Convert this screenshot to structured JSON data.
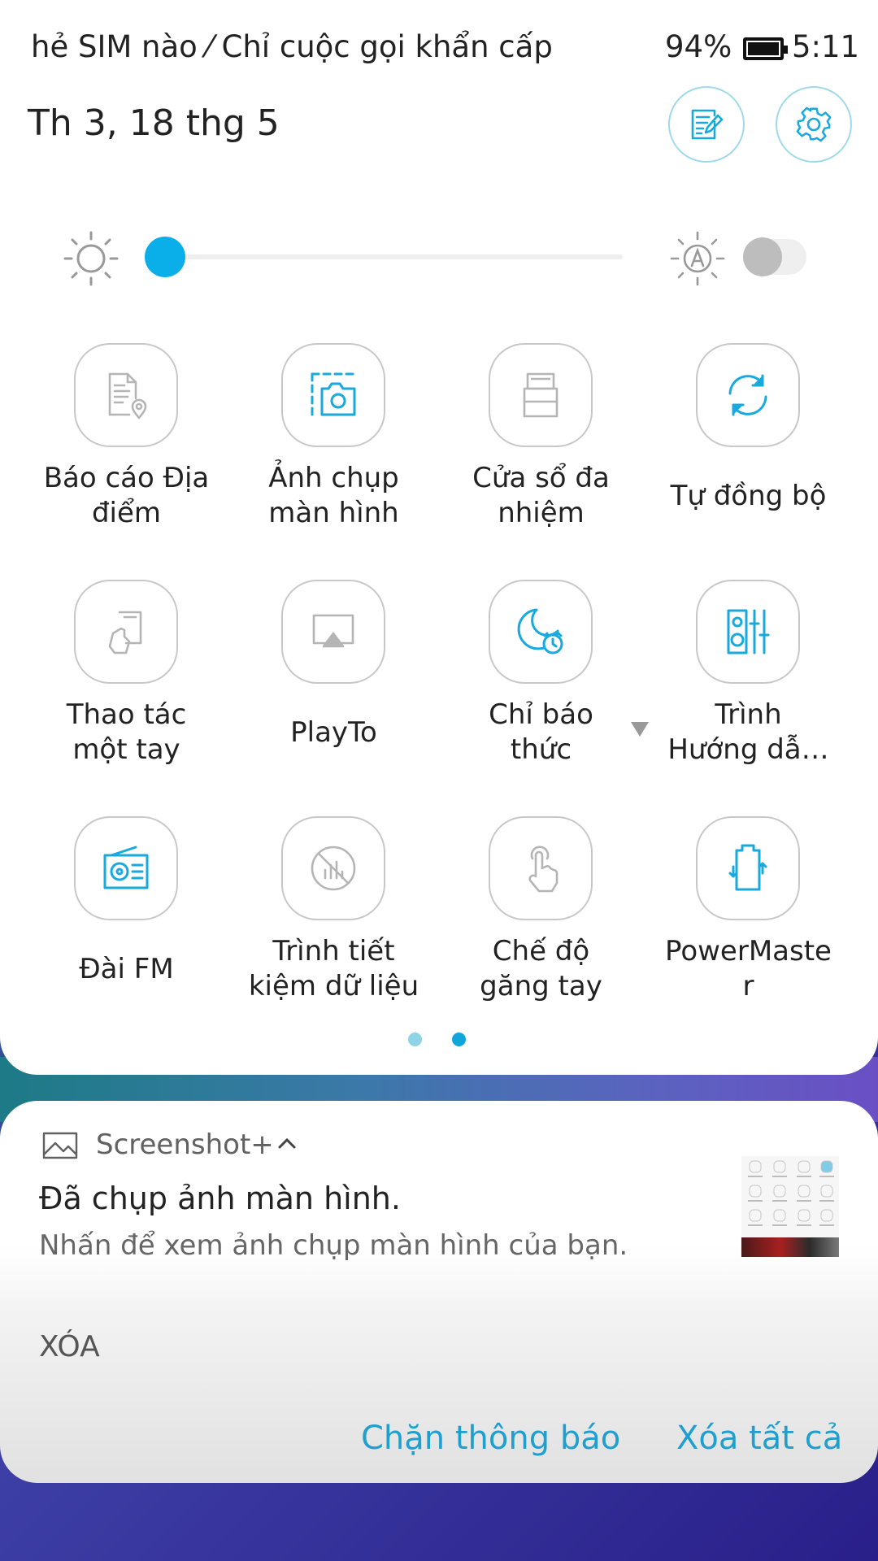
{
  "status_bar": {
    "carrier_text": "hẻ SIM nào ⁄ Chỉ cuộc gọi khẩn cấp",
    "battery_percent": "94%",
    "time": "5:11"
  },
  "header": {
    "date": "Th 3, 18 thg 5"
  },
  "brightness": {
    "level_fraction": 0.0,
    "auto": false
  },
  "tiles": [
    {
      "label_lines": [
        "Báo cáo Địa",
        "điểm"
      ],
      "icon": "location-report-icon",
      "active": false
    },
    {
      "label_lines": [
        "Ảnh chụp",
        "màn hình"
      ],
      "icon": "screenshot-icon",
      "active": true
    },
    {
      "label_lines": [
        "Cửa sổ đa",
        "nhiệm"
      ],
      "icon": "multi-window-icon",
      "active": false
    },
    {
      "label_lines": [
        "Tự đồng bộ"
      ],
      "icon": "sync-icon",
      "active": true
    },
    {
      "label_lines": [
        "Thao tác",
        "một tay"
      ],
      "icon": "one-hand-icon",
      "active": false
    },
    {
      "label_lines": [
        "PlayTo"
      ],
      "icon": "playto-icon",
      "active": false
    },
    {
      "label_lines": [
        "Chỉ báo",
        "thức"
      ],
      "icon": "alarm-only-icon",
      "active": true
    },
    {
      "label_lines": [
        "Trình",
        "Hướng dẫ…"
      ],
      "icon": "equalizer-icon",
      "active": true
    },
    {
      "label_lines": [
        "Đài FM"
      ],
      "icon": "fm-radio-icon",
      "active": true
    },
    {
      "label_lines": [
        "Trình tiết",
        "kiệm dữ liệu"
      ],
      "icon": "data-saver-icon",
      "active": false
    },
    {
      "label_lines": [
        "Chế độ",
        "găng tay"
      ],
      "icon": "glove-mode-icon",
      "active": false
    },
    {
      "label_lines": [
        "PowerMaste",
        "r"
      ],
      "icon": "power-master-icon",
      "active": true
    }
  ],
  "pager": {
    "pages": 2,
    "current": 2
  },
  "notification": {
    "app_name": "Screenshot+",
    "title": "Đã chụp ảnh màn hình.",
    "text": "Nhấn để xem ảnh chụp màn hình của bạn.",
    "action_delete": "XÓA"
  },
  "footer_actions": {
    "block": "Chặn thông báo",
    "clear_all": "Xóa tất cả"
  },
  "colors": {
    "accent": "#0aaee8",
    "inactive_icon": "#b5b5b5"
  }
}
